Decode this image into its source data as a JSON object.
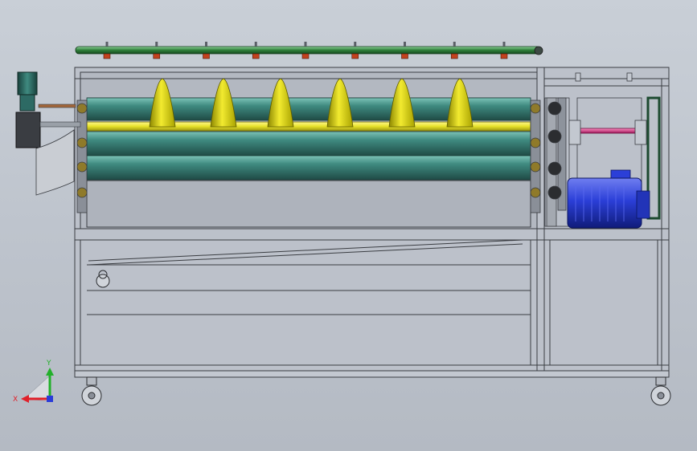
{
  "triad": {
    "x_label": "X",
    "y_label": "Y",
    "x_color": "#e0202a",
    "y_color": "#22b02a",
    "z_color": "#2a3cd8"
  },
  "palette": {
    "frame": "#b7bcc5",
    "frame_line": "#3a3d42",
    "spray_pipe": "#2f7f3a",
    "nozzle": "#c2411d",
    "auger_blade": "#d8d000",
    "shaft": "#e7e22a",
    "roller": "#3f8a80",
    "motor": "#2b3fd8",
    "gear_motor": "#2d6a64",
    "coupling_shaft": "#d8388a",
    "belt": "#2e6e48"
  },
  "components": {
    "auger_count": 6,
    "nozzle_count": 9,
    "caster_count": 2
  }
}
